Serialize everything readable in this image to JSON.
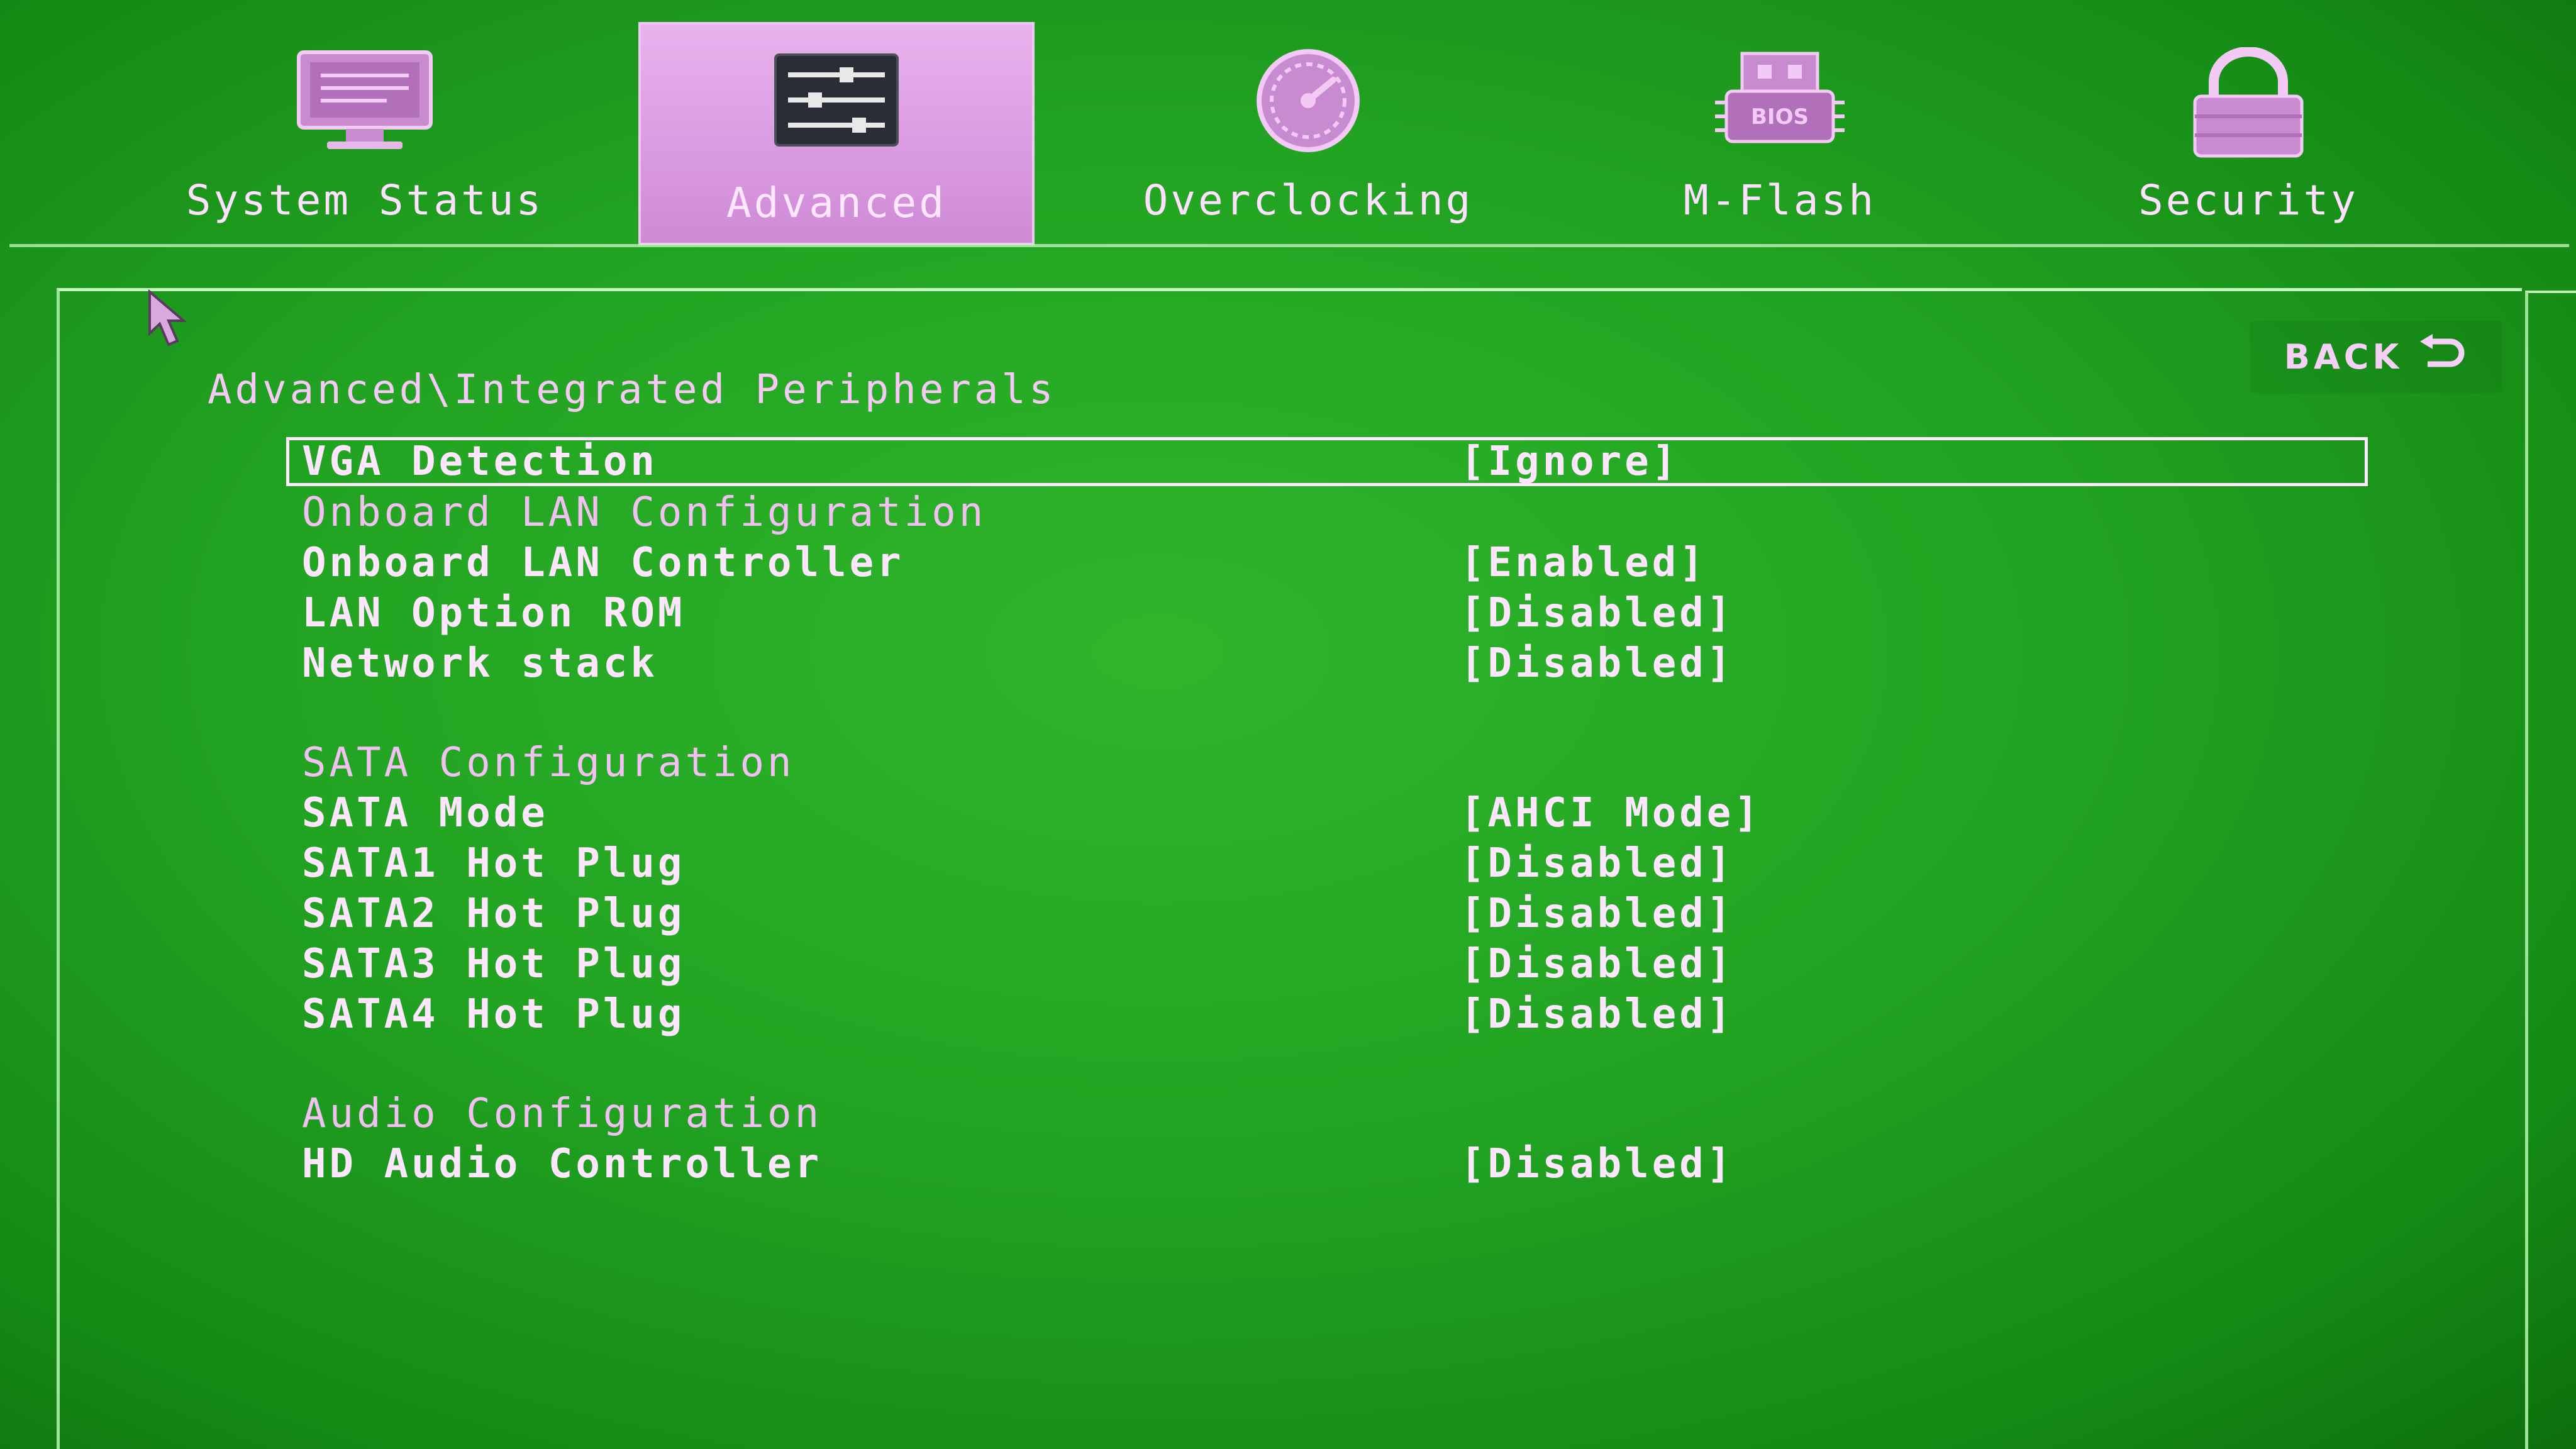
{
  "tabs": [
    {
      "label": "System Status",
      "icon": "monitor-icon",
      "active": false
    },
    {
      "label": "Advanced",
      "icon": "settings-sliders-icon",
      "active": true
    },
    {
      "label": "Overclocking",
      "icon": "speedometer-icon",
      "active": false
    },
    {
      "label": "M-Flash",
      "icon": "bios-chip-icon",
      "active": false,
      "icon_text": "BIOS"
    },
    {
      "label": "Security",
      "icon": "lock-icon",
      "active": false
    }
  ],
  "breadcrumb": "Advanced\\Integrated Peripherals",
  "back_button": {
    "label": "BACK",
    "icon": "return-arrow-icon"
  },
  "settings": [
    {
      "name": "VGA Detection",
      "value": "[Ignore]",
      "selected": true
    },
    {
      "name": "Onboard LAN Configuration",
      "value": "",
      "header": true
    },
    {
      "name": "Onboard LAN Controller",
      "value": "[Enabled]"
    },
    {
      "name": "LAN Option ROM",
      "value": "[Disabled]"
    },
    {
      "name": "Network stack",
      "value": "[Disabled]"
    },
    {
      "name": "SATA Configuration",
      "value": "",
      "header": true
    },
    {
      "name": "SATA Mode",
      "value": "[AHCI Mode]"
    },
    {
      "name": "SATA1 Hot Plug",
      "value": "[Disabled]"
    },
    {
      "name": "SATA2 Hot Plug",
      "value": "[Disabled]"
    },
    {
      "name": "SATA3 Hot Plug",
      "value": "[Disabled]"
    },
    {
      "name": "SATA4 Hot Plug",
      "value": "[Disabled]"
    },
    {
      "name": "Audio Configuration",
      "value": "",
      "header": true
    },
    {
      "name": "HD Audio Controller",
      "value": "[Disabled]"
    }
  ],
  "colors": {
    "background": "#22a322",
    "text": "#ffe6ff",
    "active_tab": "#d993df"
  }
}
